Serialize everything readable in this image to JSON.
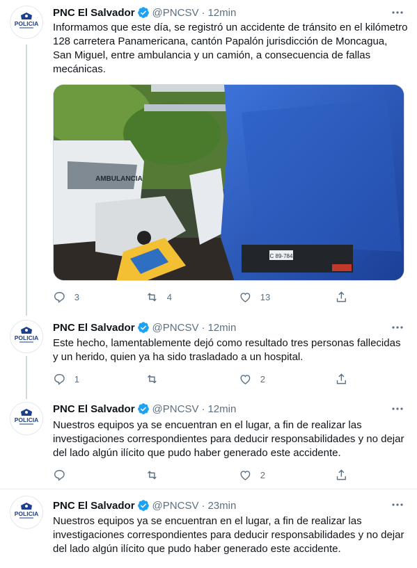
{
  "tweets": [
    {
      "name": "PNC El Salvador",
      "handle": "@PNCSV",
      "separator": "·",
      "time": "12min",
      "text": "Informamos que este día, se registró un accidente de tránsito en el kilómetro 128 carretera Panamericana, cantón Papalón jurisdicción de Moncagua, San Miguel, entre ambulancia y un camión, a consecuencia de fallas mecánicas.",
      "replies": "3",
      "retweets": "4",
      "likes": "13",
      "image": {
        "ambulance_text": "AMBULANCIA",
        "plate_text": "C 89-784"
      }
    },
    {
      "name": "PNC El Salvador",
      "handle": "@PNCSV",
      "separator": "·",
      "time": "12min",
      "text": "Este hecho, lamentablemente dejó como resultado tres personas fallecidas y un herido, quien ya ha sido trasladado a un hospital.",
      "replies": "1",
      "retweets": "",
      "likes": "2"
    },
    {
      "name": "PNC El Salvador",
      "handle": "@PNCSV",
      "separator": "·",
      "time": "12min",
      "text": "Nuestros equipos ya se encuentran en el lugar, a fin de realizar las investigaciones correspondientes para deducir responsabilidades y no dejar del lado algún ilícito que pudo haber generado este accidente.",
      "replies": "",
      "retweets": "",
      "likes": "2"
    },
    {
      "name": "PNC El Salvador",
      "handle": "@PNCSV",
      "separator": "·",
      "time": "23min",
      "text": "Nuestros equipos ya se encuentran en el lugar, a fin de realizar las investigaciones correspondientes para deducir responsabilidades y no dejar del lado algún ilícito que pudo haber generado este accidente."
    }
  ],
  "avatar_logo_text": "POLICIA",
  "icons": {
    "verified": "verified-badge-icon",
    "more": "more-options-icon",
    "reply": "reply-icon",
    "retweet": "retweet-icon",
    "like": "heart-icon",
    "share": "share-icon"
  },
  "colors": {
    "verified": "#1da1f2",
    "muted": "#5b7083",
    "text": "#0f1419",
    "divider": "#e6ecf0",
    "thread_line": "#cfd9de",
    "police_blue": "#1d3f8f"
  }
}
